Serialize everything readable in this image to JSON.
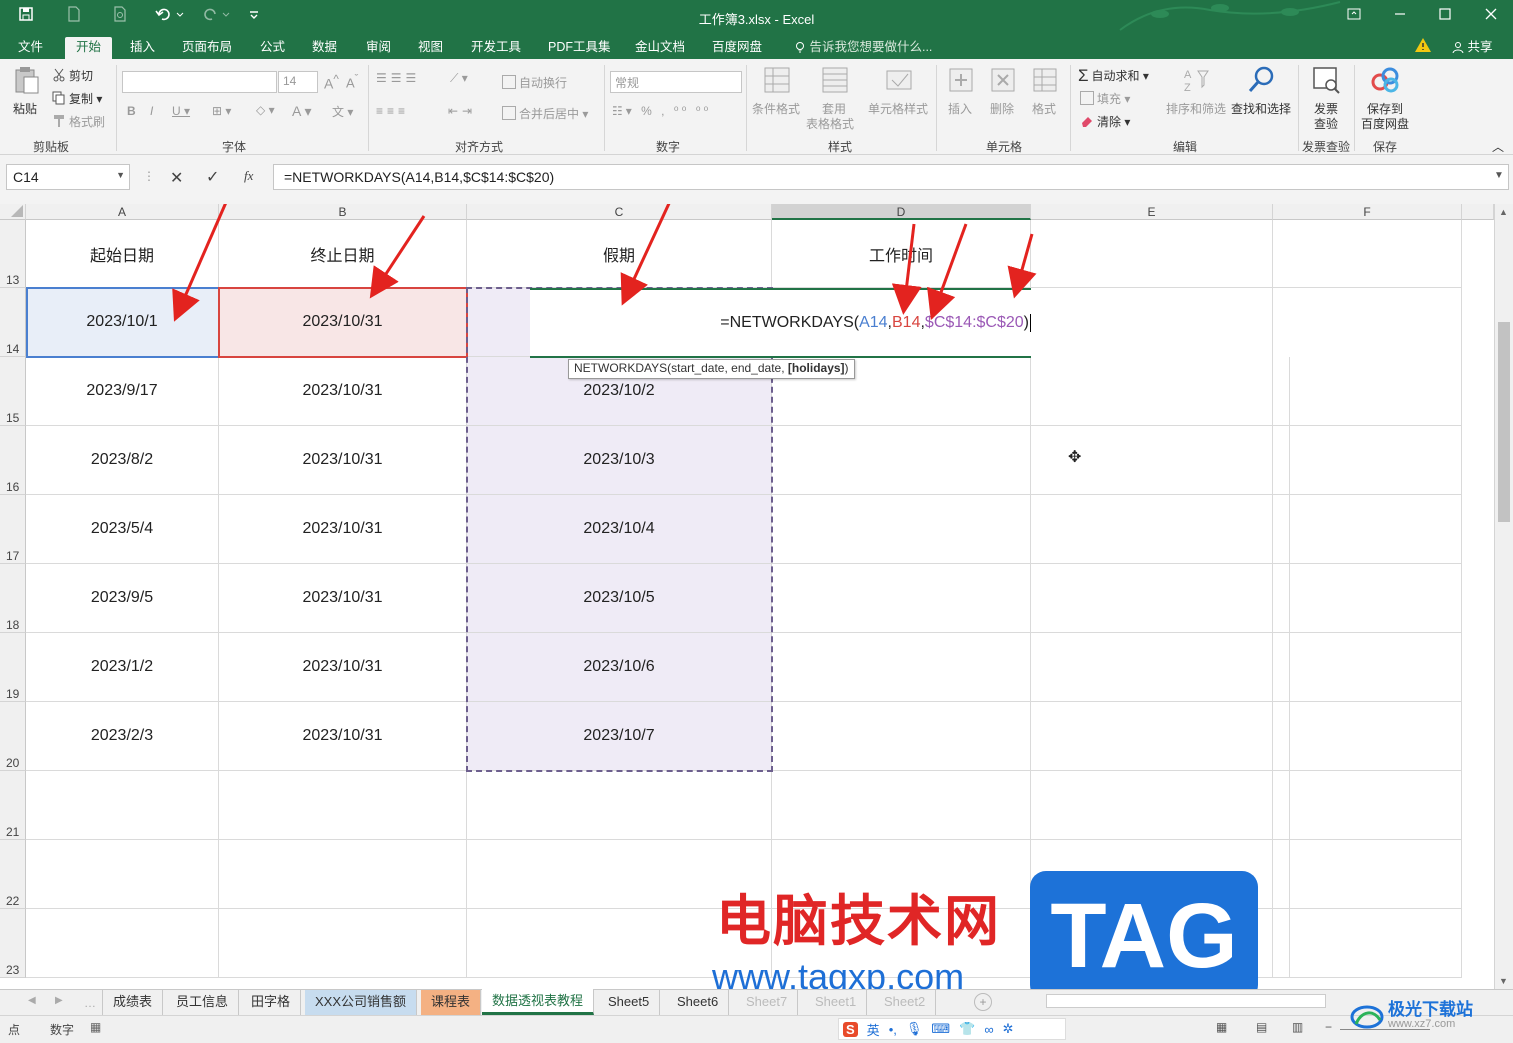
{
  "window": {
    "title": "工作簿3.xlsx - Excel"
  },
  "ribbon_tabs": [
    "文件",
    "开始",
    "插入",
    "页面布局",
    "公式",
    "数据",
    "审阅",
    "视图",
    "开发工具",
    "PDF工具集",
    "金山文档",
    "百度网盘"
  ],
  "tell_me": "告诉我您想要做什么...",
  "share": "共享",
  "clipboard": {
    "paste": "粘贴",
    "cut": "剪切",
    "copy": "复制",
    "format_painter": "格式刷",
    "group": "剪贴板"
  },
  "font": {
    "size": "14",
    "group": "字体"
  },
  "alignment": {
    "wrap": "自动换行",
    "merge": "合并后居中",
    "group": "对齐方式"
  },
  "number": {
    "format": "常规",
    "group": "数字"
  },
  "styles": {
    "conditional": "条件格式",
    "table_a": "套用",
    "table_b": "表格格式",
    "cell_styles": "单元格样式",
    "group": "样式"
  },
  "cells": {
    "insert": "插入",
    "delete": "删除",
    "format": "格式",
    "group": "单元格"
  },
  "editing": {
    "autosum": "自动求和",
    "fill": "填充",
    "clear": "清除",
    "sort": "排序和筛选",
    "find": "查找和选择",
    "group": "编辑"
  },
  "invoice": {
    "label_a": "发票",
    "label_b": "查验",
    "group": "发票查验"
  },
  "save": {
    "label_a": "保存到",
    "label_b": "百度网盘",
    "group": "保存"
  },
  "formula_bar": {
    "name_box": "C14",
    "formula": "=NETWORKDAYS(A14,B14,$C$14:$C$20)"
  },
  "columns": [
    "A",
    "B",
    "C",
    "D",
    "E",
    "F"
  ],
  "rows": [
    "13",
    "14",
    "15",
    "16",
    "17",
    "18",
    "19",
    "20",
    "21",
    "22",
    "23"
  ],
  "headers": {
    "a": "起始日期",
    "b": "终止日期",
    "c": "假期",
    "d": "工作时间"
  },
  "data_rows": [
    {
      "a": "2023/10/1",
      "b": "2023/10/31",
      "c": ""
    },
    {
      "a": "2023/9/17",
      "b": "2023/10/31",
      "c": "2023/10/2"
    },
    {
      "a": "2023/8/2",
      "b": "2023/10/31",
      "c": "2023/10/3"
    },
    {
      "a": "2023/5/4",
      "b": "2023/10/31",
      "c": "2023/10/4"
    },
    {
      "a": "2023/9/5",
      "b": "2023/10/31",
      "c": "2023/10/5"
    },
    {
      "a": "2023/1/2",
      "b": "2023/10/31",
      "c": "2023/10/6"
    },
    {
      "a": "2023/2/3",
      "b": "2023/10/31",
      "c": "2023/10/7"
    }
  ],
  "edit_formula": {
    "prefix": "=NETWORKDAYS(",
    "arg1": "A14",
    "comma1": ",",
    "arg2": "B14",
    "comma2": ",",
    "arg3": "$C$14:$C$20",
    "suffix": ")"
  },
  "tooltip": {
    "prefix": "NETWORKDAYS(start_date, end_date, ",
    "bold": "[holidays]",
    "suffix": ")"
  },
  "sheet_tabs": [
    "成绩表",
    "员工信息",
    "田字格",
    "XXX公司销售额",
    "课程表",
    "数据透视表教程",
    "Sheet5",
    "Sheet6",
    "Sheet7",
    "Sheet1",
    "Sheet2"
  ],
  "status": {
    "mode": "点",
    "num": "数字"
  },
  "watermark": {
    "title": "电脑技术网",
    "url": "www.tagxp.com",
    "logo": "TAG",
    "site": "极光下载站",
    "site_url": "www.xz7.com"
  },
  "colors": {
    "excel_green": "#217346",
    "arrow_red": "#e3231f",
    "holiday_fill": "#efebf6",
    "a_ref": "#4a7fd0",
    "b_ref": "#d8453f",
    "c_ref": "#9b59b6"
  }
}
